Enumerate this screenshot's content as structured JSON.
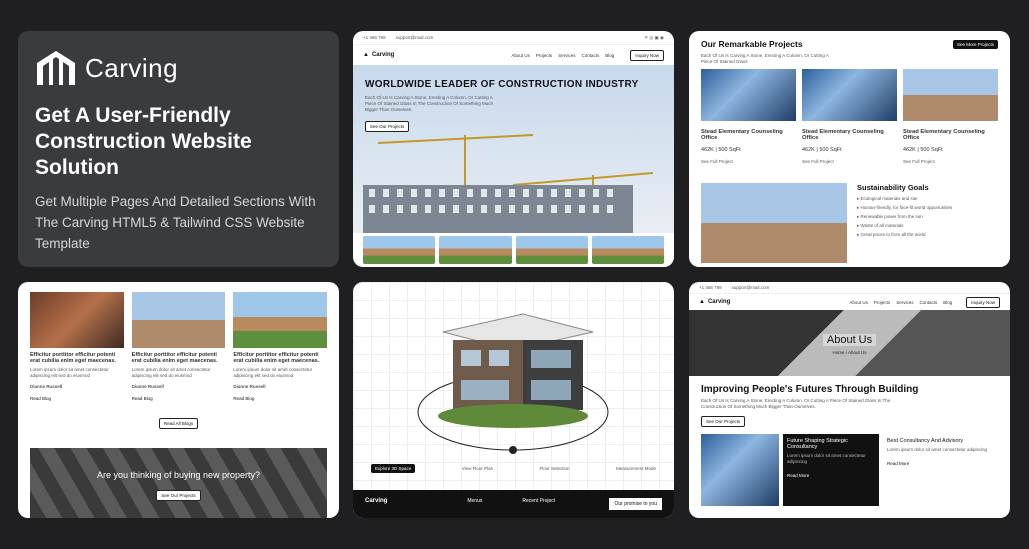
{
  "hero": {
    "brand": "Carving",
    "title": "Get A User-Friendly Construction Website Solution",
    "description": "Get Multiple Pages And Detailed Sections With The Carving HTML5 & Tailwind CSS Website Template"
  },
  "home": {
    "nav_links": [
      "About Us",
      "Projects",
      "Services",
      "Contacts",
      "Blog"
    ],
    "cta": "Inquiry Now",
    "headline": "WORLDWIDE LEADER OF CONSTRUCTION INDUSTRY",
    "subtext": "Each Of Us Is Carving A Stone, Erecting A Column, Or Cutting A Piece Of Stained Glass In The Construction Of Something Much Bigger Than Ourselves.",
    "button": "See Our Projects",
    "brand": "Carving"
  },
  "projects": {
    "title": "Our Remarkable Projects",
    "see_more": "See More Projects",
    "items": [
      {
        "name": "Stead Elementary Counseling Office",
        "price": "462K | 500 SqFt",
        "link": "See Full Project"
      },
      {
        "name": "Stead Elementary Counseling Office",
        "price": "462K | 500 SqFt",
        "link": "See Full Project"
      },
      {
        "name": "Stead Elementary Counseling Office",
        "price": "462K | 500 SqFt",
        "link": "See Full Project"
      }
    ],
    "goals_title": "Sustainability Goals"
  },
  "blog": {
    "posts": [
      {
        "title": "Efficitur porttitor efficitur potenti erat cubilia enim eget maecenas.",
        "author": "Dianne Russell",
        "link": "Read Blog"
      },
      {
        "title": "Efficitur porttitor efficitur potenti erat cubilia enim eget maecenas.",
        "author": "Dianne Russell",
        "link": "Read Blog"
      },
      {
        "title": "Efficitur porttitor efficitur potenti erat cubilia enim eget maecenas.",
        "author": "Dianne Russell",
        "link": "Read Blog"
      }
    ],
    "read_all": "Read All Blogs",
    "banner": "Are you thinking of buying new property?",
    "banner_button": "See Our Projects"
  },
  "house": {
    "buttons": [
      "Explore 3D Space",
      "View Floor Plan",
      "Floor Selection",
      "Measurement Mode"
    ],
    "footer_brand": "Carving",
    "footer_cols": [
      "Menus",
      "Recent Project"
    ],
    "promise": "Our promise to you"
  },
  "about": {
    "nav_links": [
      "About Us",
      "Projects",
      "Services",
      "Contacts",
      "Blog"
    ],
    "cta": "Inquiry Now",
    "brand": "Carving",
    "title": "About Us",
    "breadcrumb": "Home / About Us",
    "headline": "Improving People's Futures Through Building",
    "subtext": "Each Of Us Is Carving A Stone, Erecting A Column, Or Cutting A Piece Of Stained Glass In The Construction Of Something Much Bigger Than Ourselves.",
    "button": "See Our Projects",
    "card1_title": "Future Shaping Strategic Consultancy",
    "card1_link": "Read More",
    "card2_title": "Best Consultancy And Advisory",
    "card2_link": "Read More"
  }
}
